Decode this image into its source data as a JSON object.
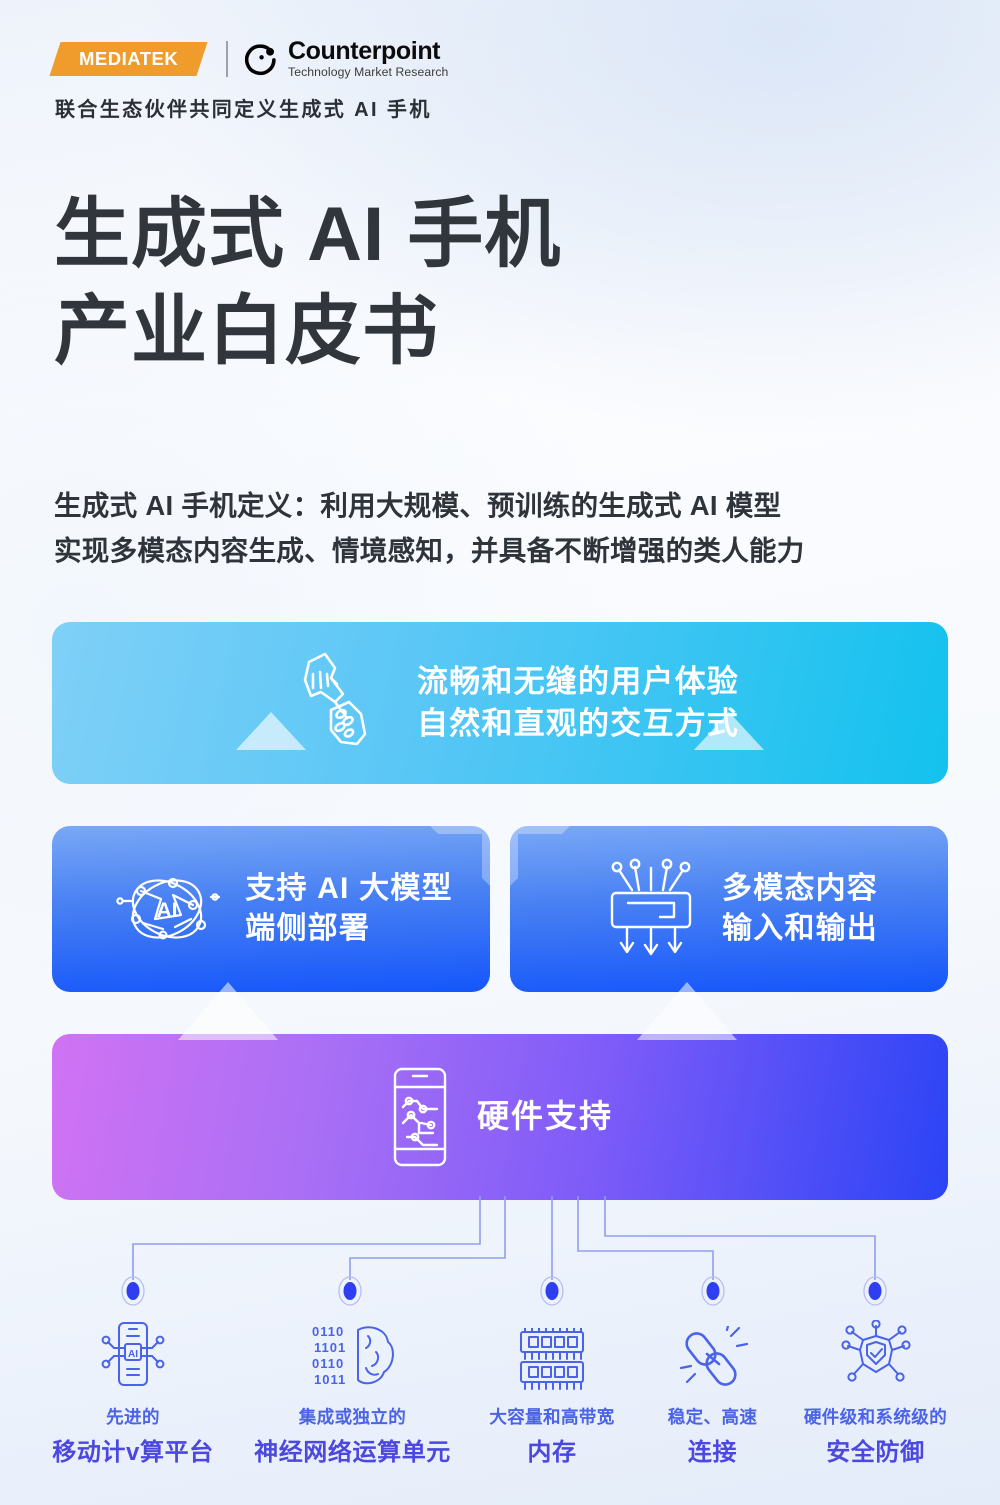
{
  "header": {
    "mediatek_logo_text": "MEDIATEK",
    "counterpoint_name": "Counterpoint",
    "counterpoint_sub": "Technology Market Research",
    "tagline": "联合生态伙伴共同定义生成式 AI 手机"
  },
  "title": {
    "line1": "生成式 AI 手机",
    "line2": "产业白皮书"
  },
  "definition": {
    "line1": "生成式 AI 手机定义：利用大规模、预训练的生成式 AI 模型",
    "line2": "实现多模态内容生成、情境感知，并具备不断增强的类人能力"
  },
  "cards": {
    "experience": {
      "icon": "touch-gesture-icon",
      "line1": "流畅和无缝的用户体验",
      "line2": "自然和直观的交互方式",
      "color": "#13c2ee"
    },
    "model": {
      "icon": "ai-network-icon",
      "line1": "支持 AI 大模型",
      "line2": "端侧部署",
      "color": "#1556fb"
    },
    "modal": {
      "icon": "multimodal-io-icon",
      "line1": "多模态内容",
      "line2": "输入和输出",
      "color": "#1556fb"
    },
    "hardware": {
      "icon": "phone-circuit-icon",
      "label": "硬件支持",
      "color": "#7f5cf8"
    }
  },
  "features": [
    {
      "icon": "ai-chip-phone-icon",
      "line1": "先进的",
      "line2": "移动计v算平台"
    },
    {
      "icon": "binary-brain-icon",
      "line1": "集成或独立的",
      "line2": "神经网络运算单元"
    },
    {
      "icon": "memory-chip-icon",
      "line1": "大容量和高带宽",
      "line2": "内存"
    },
    {
      "icon": "chain-link-icon",
      "line1": "稳定、高速",
      "line2": "连接"
    },
    {
      "icon": "shield-network-icon",
      "line1": "硬件级和系统级的",
      "line2": "安全防御"
    }
  ],
  "accent": {
    "feature_text": "#4b47e0",
    "connector_line": "#8f9ff0",
    "dot": "#2f3ef0"
  }
}
